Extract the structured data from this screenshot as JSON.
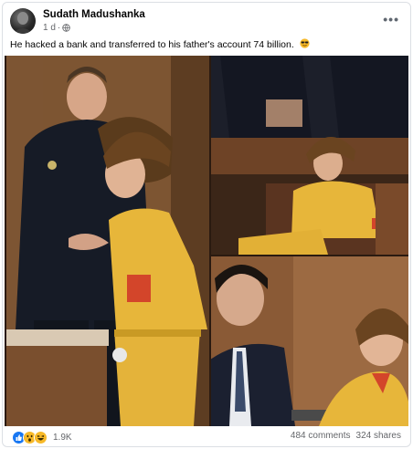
{
  "post": {
    "author": "Sudath Madushanka",
    "time": "1 d",
    "caption": "He hacked a bank and transferred to his father's account 74 billion.",
    "caption_emoji": "sunglasses-emoji"
  },
  "icons": {
    "privacy": "globe-icon",
    "menu": "more-options-icon",
    "reactions": [
      "like-icon",
      "wow-icon",
      "haha-icon"
    ]
  },
  "footer": {
    "reaction_count": "1.9K",
    "comments": "484 comments",
    "shares": "324 shares"
  },
  "colors": {
    "like_blue": "#1877f2",
    "reaction_yellow": "#f7b928",
    "text_secondary": "#65676b"
  }
}
